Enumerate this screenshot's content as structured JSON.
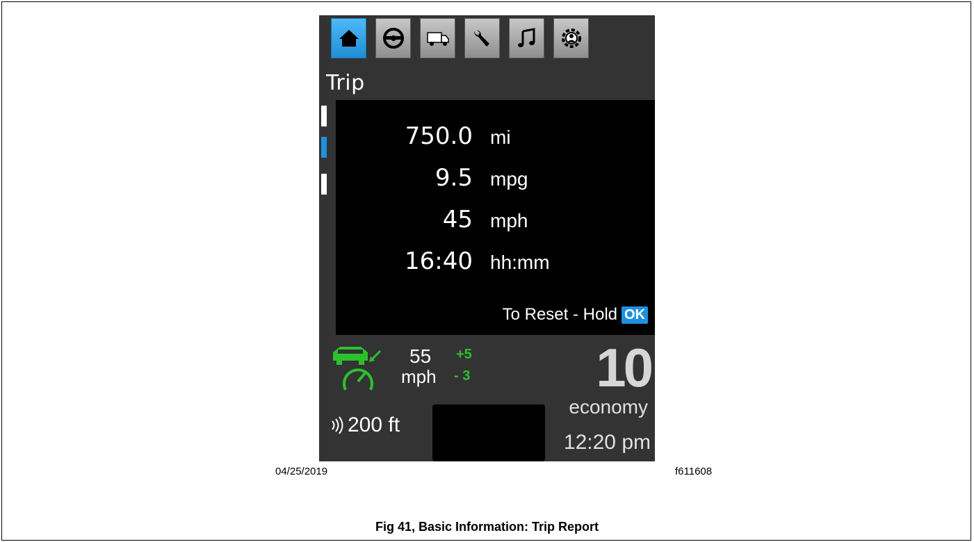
{
  "screen": {
    "tabs": [
      {
        "icon": "home-icon",
        "active": true
      },
      {
        "icon": "steering-wheel-icon",
        "active": false
      },
      {
        "icon": "truck-icon",
        "active": false
      },
      {
        "icon": "wrench-icon",
        "active": false
      },
      {
        "icon": "music-note-icon",
        "active": false
      },
      {
        "icon": "profile-settings-icon",
        "active": false
      }
    ],
    "title": "Trip",
    "rows": [
      {
        "value": "750.0",
        "unit": "mi"
      },
      {
        "value": "9.5",
        "unit": "mpg"
      },
      {
        "value": "45",
        "unit": "mph"
      },
      {
        "value": "16:40",
        "unit": "hh:mm"
      }
    ],
    "reset_text": "To Reset - Hold",
    "ok_label": "OK",
    "cruise": {
      "speed": "55",
      "unit": "mph",
      "plus": "+5",
      "minus": "- 3"
    },
    "distance": "200 ft",
    "gear": "10",
    "mode": "economy",
    "time": "12:20 pm"
  },
  "footer": {
    "date": "04/25/2019",
    "figure_id": "f611608",
    "caption": "Fig 41, Basic Information: Trip Report"
  },
  "colors": {
    "accent": "#1e90e0",
    "screen_bg": "#333333",
    "panel_bg": "#000000",
    "cruise_green": "#2bc12b"
  }
}
